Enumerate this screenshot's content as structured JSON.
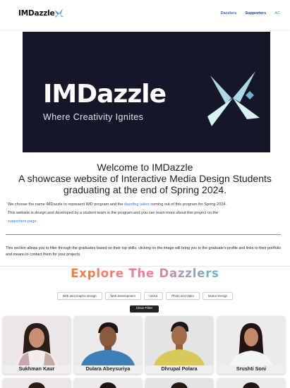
{
  "header": {
    "logo_text": "IMDazzle",
    "nav": [
      {
        "label": "Dazzlers",
        "state": "active"
      },
      {
        "label": "Supporters",
        "state": "normal"
      },
      {
        "label": "AC",
        "state": "accent"
      }
    ]
  },
  "hero": {
    "wordmark": "IMDazzle",
    "tagline": "Where Creativity Ignites"
  },
  "welcome": {
    "line1": "Welcome to IMDazzle",
    "line2": "A showcase website of Interactive Media Design Students",
    "line3": "graduating at the end of Spring 2024."
  },
  "intro": {
    "part1": "We choose the name IMDazzle to represent IMD program and the ",
    "link1": "dazzling talent",
    "part2": " coming out of this program for Spring 2024.",
    "part3": "This website is design and developed by a student team in the program and you can learn more about this project on the",
    "link2": "supporters page",
    "part4": "."
  },
  "filter_note": "This section allows you to filter through the graduates based on their top skills, clicking on the image will bring you to the graduate's profile and links to their portfolio and means to contact them for your projects.",
  "explore": {
    "title": "Explore The Dazzlers"
  },
  "filters": {
    "chips": [
      "Web and Graphic Design",
      "Web Development",
      "UX/UI",
      "Photo and Video",
      "Motion Design"
    ],
    "clear_label": "Clear Filter"
  },
  "graduates": [
    {
      "name": "Sukhman Kaur"
    },
    {
      "name": "Dulara Abeysuriya"
    },
    {
      "name": "Dhrupal Polara"
    },
    {
      "name": "Srushti Soni"
    }
  ],
  "colors": {
    "nav_link": "#1a3f8a",
    "nav_ac": "#2fa66a",
    "hero_bg": "#161629",
    "hero_x": "#bfe9ea",
    "link": "#3a7bd5",
    "explore_gradient": [
      "#f27a3a",
      "#ee7fa0",
      "#64b7c9"
    ]
  }
}
